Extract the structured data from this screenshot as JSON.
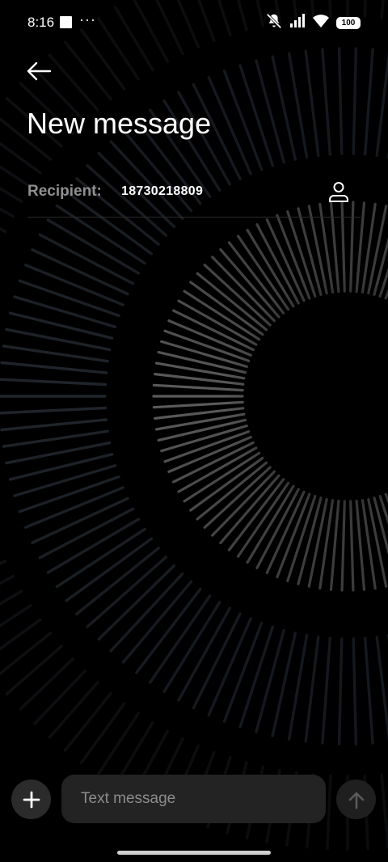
{
  "status_bar": {
    "time": "8:16",
    "dots": "···",
    "battery": "100",
    "icons": [
      "notification-square-icon",
      "mute-icon",
      "signal-icon",
      "wifi-icon",
      "battery-icon"
    ]
  },
  "header": {
    "back_icon": "arrow-left-icon",
    "title": "New message"
  },
  "recipient": {
    "label": "Recipient:",
    "value": "18730218809",
    "contact_icon": "person-icon"
  },
  "composer": {
    "add_icon": "plus-icon",
    "placeholder": "Text message",
    "send_icon": "arrow-up-icon"
  },
  "colors": {
    "background": "#000000",
    "label_gray": "#8f8f8f",
    "input_bg": "#232323",
    "button_bg": "#2b2b2b"
  }
}
